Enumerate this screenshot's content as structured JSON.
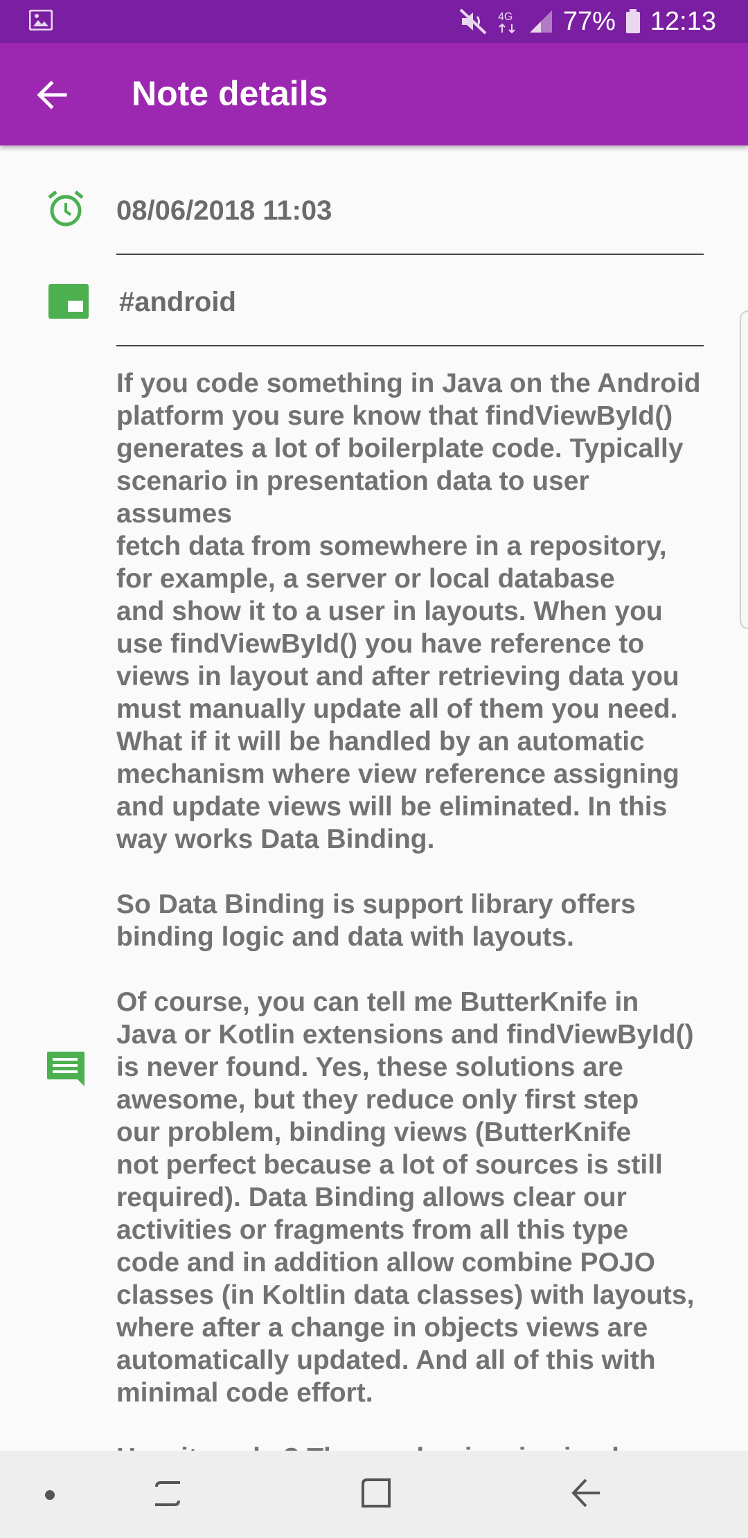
{
  "status_bar": {
    "battery_text": "77%",
    "time": "12:13",
    "network": "4G",
    "icons": [
      "gallery-icon",
      "mute-icon",
      "signal-icon",
      "battery-icon"
    ]
  },
  "app_bar": {
    "title": "Note details",
    "background": "#9c27b0",
    "status_background": "#7b1fa2"
  },
  "note": {
    "datetime": "08/06/2018 11:03",
    "tag": "#android",
    "accent_color": "#4caf50",
    "text": "If you code something in Java on the Android\nplatform you sure know that findViewById()\ngenerates a lot of boilerplate code. Typically\nscenario in presentation data to user assumes\nfetch data from somewhere in a repository,\nfor example, a server or local database\nand show it to a user in layouts. When you\nuse findViewById() you have reference to\nviews in layout and after retrieving data you\nmust manually update all of them you need.\nWhat if it will be handled by an automatic\nmechanism where view reference assigning\nand update views will be eliminated. In this\nway works Data Binding.\n\nSo Data Binding is support library offers\nbinding logic and data with layouts.\n\nOf course, you can tell me ButterKnife in\nJava or Kotlin extensions and findViewById()\nis never found. Yes, these solutions are\nawesome, but they reduce only first step\nour problem, binding views (ButterKnife\nnot perfect because a lot of sources is still\nrequired). Data Binding allows clear our\nactivities or fragments from all this type\ncode and in addition allow combine POJO\nclasses (in Koltlin data classes) with layouts,\nwhere after a change in objects views are\nautomatically updated. And all of this with\nminimal code effort.\n\nHow it works? The mechanism is simple."
  },
  "nav_bar": {
    "items": [
      "dot-icon",
      "recent-apps-icon",
      "home-icon",
      "back-icon"
    ]
  }
}
